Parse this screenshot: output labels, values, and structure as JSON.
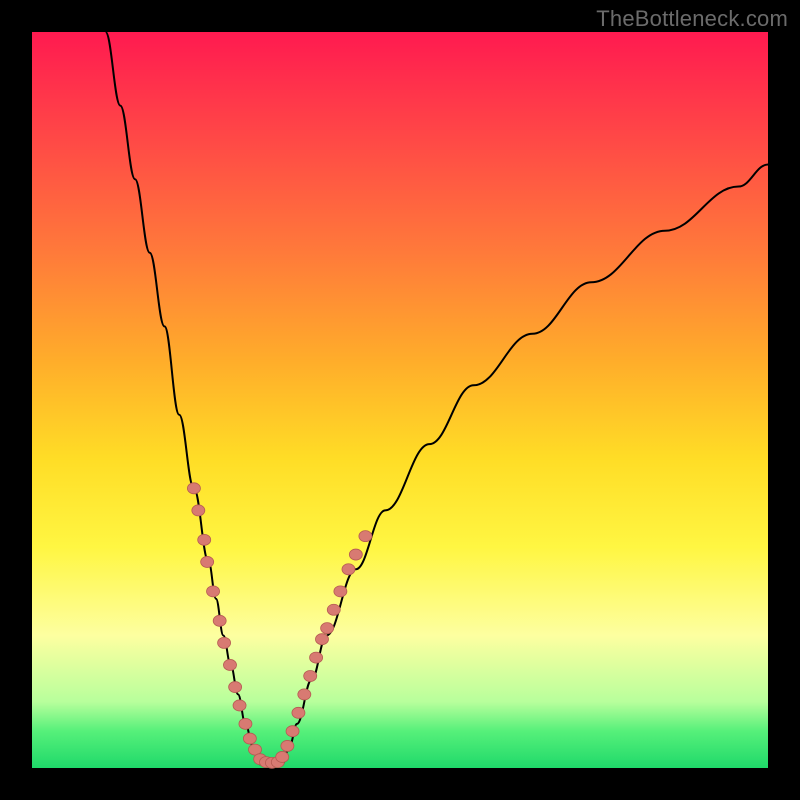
{
  "watermark": "TheBottleneck.com",
  "colors": {
    "frame": "#000000",
    "gradient_top": "#ff1a50",
    "gradient_bottom": "#1fd96a",
    "curve": "#000000",
    "dot_fill": "#d87a72",
    "dot_stroke": "#b55a52"
  },
  "chart_data": {
    "type": "line",
    "title": "",
    "xlabel": "",
    "ylabel": "",
    "xlim": [
      0,
      100
    ],
    "ylim": [
      0,
      100
    ],
    "series": [
      {
        "name": "left-branch",
        "x": [
          10,
          12,
          14,
          16,
          18,
          20,
          22,
          24,
          25,
          26,
          27,
          28,
          29,
          30,
          31
        ],
        "y": [
          100,
          90,
          80,
          70,
          60,
          48,
          38,
          28,
          23,
          18,
          14,
          10,
          6,
          3,
          0.5
        ]
      },
      {
        "name": "right-branch",
        "x": [
          34,
          35,
          36,
          38,
          40,
          44,
          48,
          54,
          60,
          68,
          76,
          86,
          96,
          100
        ],
        "y": [
          0.5,
          3,
          6,
          12,
          18,
          27,
          35,
          44,
          52,
          59,
          66,
          73,
          79,
          82
        ]
      }
    ],
    "scatter": {
      "name": "data-points",
      "points": [
        {
          "x": 22.0,
          "y": 38
        },
        {
          "x": 22.6,
          "y": 35
        },
        {
          "x": 23.4,
          "y": 31
        },
        {
          "x": 23.8,
          "y": 28
        },
        {
          "x": 24.6,
          "y": 24
        },
        {
          "x": 25.5,
          "y": 20
        },
        {
          "x": 26.1,
          "y": 17
        },
        {
          "x": 26.9,
          "y": 14
        },
        {
          "x": 27.6,
          "y": 11
        },
        {
          "x": 28.2,
          "y": 8.5
        },
        {
          "x": 29.0,
          "y": 6
        },
        {
          "x": 29.6,
          "y": 4
        },
        {
          "x": 30.3,
          "y": 2.5
        },
        {
          "x": 31.0,
          "y": 1.2
        },
        {
          "x": 31.8,
          "y": 0.8
        },
        {
          "x": 32.6,
          "y": 0.7
        },
        {
          "x": 33.4,
          "y": 0.8
        },
        {
          "x": 34.0,
          "y": 1.5
        },
        {
          "x": 34.7,
          "y": 3
        },
        {
          "x": 35.4,
          "y": 5
        },
        {
          "x": 36.2,
          "y": 7.5
        },
        {
          "x": 37.0,
          "y": 10
        },
        {
          "x": 37.8,
          "y": 12.5
        },
        {
          "x": 38.6,
          "y": 15
        },
        {
          "x": 39.4,
          "y": 17.5
        },
        {
          "x": 40.1,
          "y": 19
        },
        {
          "x": 41.0,
          "y": 21.5
        },
        {
          "x": 41.9,
          "y": 24
        },
        {
          "x": 43.0,
          "y": 27
        },
        {
          "x": 44.0,
          "y": 29
        },
        {
          "x": 45.3,
          "y": 31.5
        }
      ]
    }
  }
}
